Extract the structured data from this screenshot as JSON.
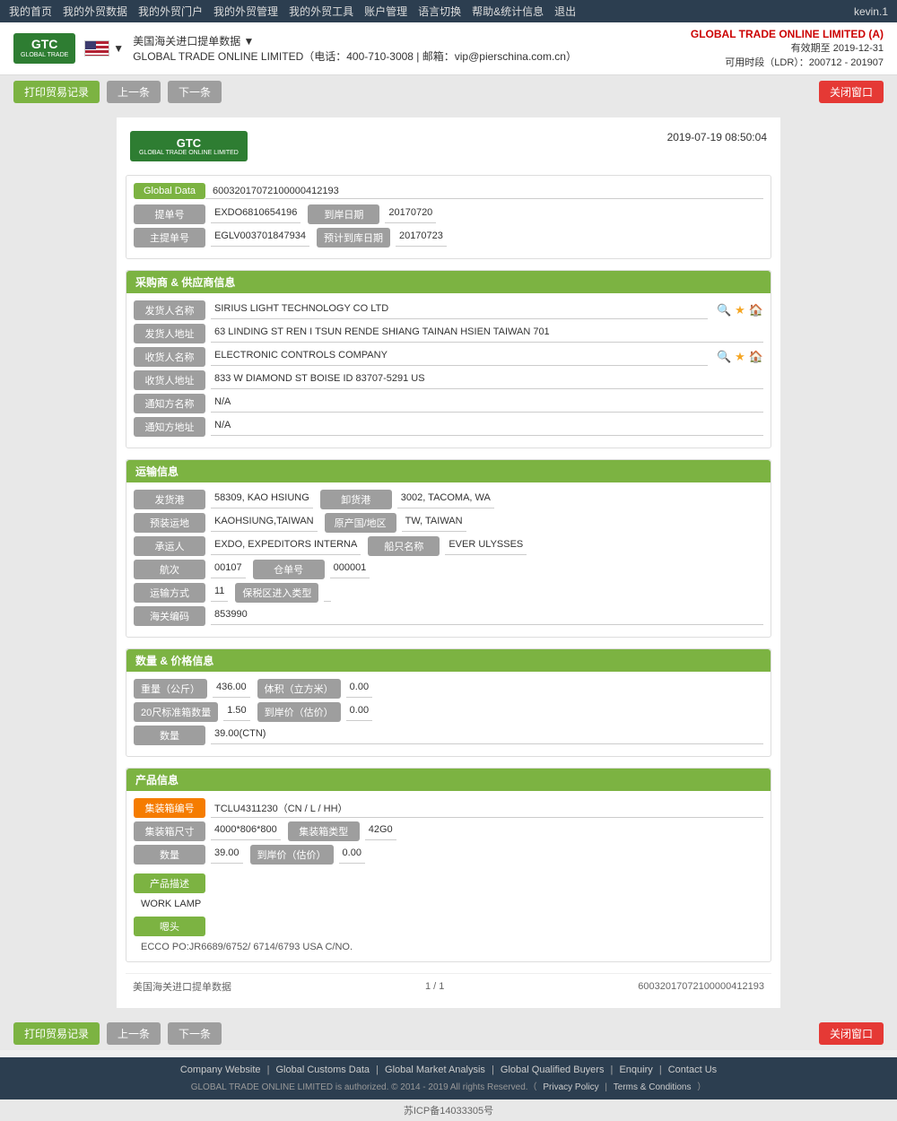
{
  "topnav": {
    "items": [
      "我的首页",
      "我的外贸数据",
      "我的外贸门户",
      "我的外贸管理",
      "我的外贸工具",
      "账户管理",
      "语言切换",
      "帮助&统计信息",
      "退出"
    ],
    "user": "kevin.1"
  },
  "header": {
    "logo_text": "GTC",
    "logo_sub": "GLOBAL TRADE ONLINE LIMITED",
    "title": "美国海关进口提单数据 ▼",
    "subtitle": "GLOBAL TRADE ONLINE LIMITED（电话：400-710-3008  |  邮箱：vip@pierschina.com.cn）",
    "company": "GLOBAL TRADE ONLINE LIMITED (A)",
    "validity": "有效期至 2019-12-31",
    "ldr": "可用时段（LDR）：200712 - 201907"
  },
  "toolbar": {
    "print_btn": "打印贸易记录",
    "prev_btn": "上一条",
    "next_btn": "下一条",
    "close_btn": "关闭窗口"
  },
  "document": {
    "timestamp": "2019-07-19  08:50:04",
    "global_data_label": "Global Data",
    "global_data_value": "60032017072100000412193",
    "bill_no_label": "提单号",
    "bill_no_value": "EXDO6810654196",
    "arrival_date_label": "到岸日期",
    "arrival_date_value": "20170720",
    "master_bill_label": "主提单号",
    "master_bill_value": "EGLV003701847934",
    "estimated_arrival_label": "预计到库日期",
    "estimated_arrival_value": "20170723"
  },
  "buyer_supplier": {
    "section_title": "采购商 & 供应商信息",
    "shipper_name_label": "发货人名称",
    "shipper_name_value": "SIRIUS LIGHT TECHNOLOGY CO LTD",
    "shipper_addr_label": "发货人地址",
    "shipper_addr_value": "63 LINDING ST REN I TSUN RENDE SHIANG TAINAN HSIEN TAIWAN 701",
    "consignee_name_label": "收货人名称",
    "consignee_name_value": "ELECTRONIC CONTROLS COMPANY",
    "consignee_addr_label": "收货人地址",
    "consignee_addr_value": "833 W DIAMOND ST BOISE ID 83707-5291 US",
    "notify_name_label": "通知方名称",
    "notify_name_value": "N/A",
    "notify_addr_label": "通知方地址",
    "notify_addr_value": "N/A"
  },
  "shipping": {
    "section_title": "运输信息",
    "origin_port_label": "发货港",
    "origin_port_value": "58309, KAO HSIUNG",
    "dest_port_label": "卸货港",
    "dest_port_value": "3002, TACOMA, WA",
    "pre_carrier_label": "预装运地",
    "pre_carrier_value": "KAOHSIUNG,TAIWAN",
    "origin_country_label": "原产国/地区",
    "origin_country_value": "TW, TAIWAN",
    "carrier_label": "承运人",
    "carrier_value": "EXDO, EXPEDITORS INTERNA",
    "vessel_label": "船只名称",
    "vessel_value": "EVER ULYSSES",
    "voyage_label": "航次",
    "voyage_value": "00107",
    "warehouse_label": "仓单号",
    "warehouse_value": "000001",
    "transport_label": "运输方式",
    "transport_value": "11",
    "ftz_type_label": "保税区进入类型",
    "ftz_type_value": "",
    "customs_code_label": "海关编码",
    "customs_code_value": "853990"
  },
  "quantity_price": {
    "section_title": "数量 & 价格信息",
    "weight_label": "重量（公斤）",
    "weight_value": "436.00",
    "volume_label": "体积（立方米）",
    "volume_value": "0.00",
    "container_20_label": "20尺标准箱数量",
    "container_20_value": "1.50",
    "arrival_price_label": "到岸价（估价）",
    "arrival_price_value": "0.00",
    "quantity_label": "数量",
    "quantity_value": "39.00(CTN)"
  },
  "product": {
    "section_title": "产品信息",
    "container_no_label": "集装箱编号",
    "container_no_value": "TCLU4311230（CN / L / HH）",
    "container_size_label": "集装箱尺寸",
    "container_size_value": "4000*806*800",
    "container_type_label": "集装箱类型",
    "container_type_value": "42G0",
    "quantity_label": "数量",
    "quantity_value": "39.00",
    "arrival_price_label": "到岸价（估价）",
    "arrival_price_value": "0.00",
    "desc_title": "产品描述",
    "desc_value": "WORK LAMP",
    "remarks_title": "嗯头",
    "remarks_value": "ECCO PO:JR6689/6752/ 6714/6793 USA C/NO."
  },
  "doc_footer": {
    "source": "美国海关进口提单数据",
    "page": "1 / 1",
    "record_id": "60032017072100000412193"
  },
  "bottom_toolbar": {
    "print_btn": "打印贸易记录",
    "prev_btn": "上一条",
    "next_btn": "下一条",
    "close_btn": "关闭窗口"
  },
  "page_footer": {
    "links": [
      "Company Website",
      "Global Customs Data",
      "Global Market Analysis",
      "Global Qualified Buyers",
      "Enquiry",
      "Contact Us"
    ],
    "copyright": "GLOBAL TRADE ONLINE LIMITED is authorized. © 2014 - 2019 All rights Reserved.（",
    "privacy": "Privacy Policy",
    "pipe1": " | ",
    "terms": "Terms & Conditions",
    "close_paren": "）",
    "icp": "苏ICP备14033305号"
  }
}
